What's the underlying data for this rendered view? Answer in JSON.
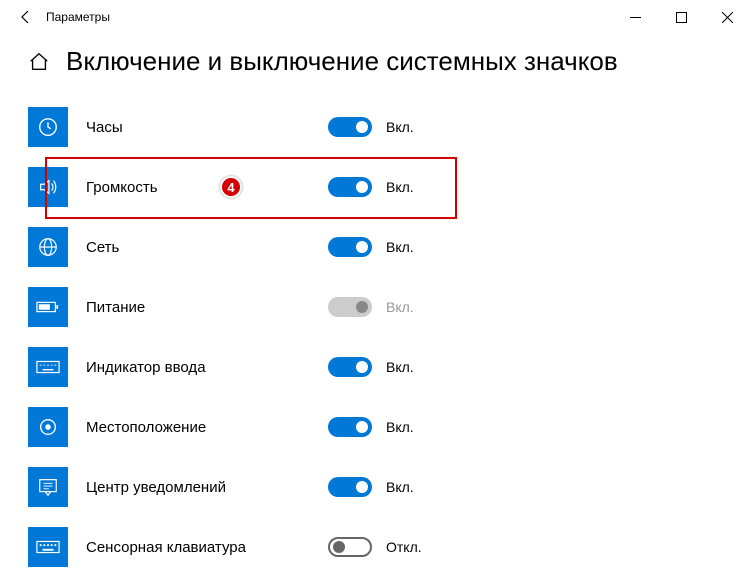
{
  "window": {
    "title": "Параметры"
  },
  "page": {
    "title": "Включение и выключение системных значков"
  },
  "states": {
    "on": "Вкл.",
    "off": "Откл."
  },
  "callout": {
    "number": "4"
  },
  "items": [
    {
      "label": "Часы",
      "state": "on"
    },
    {
      "label": "Громкость",
      "state": "on"
    },
    {
      "label": "Сеть",
      "state": "on"
    },
    {
      "label": "Питание",
      "state": "disabled",
      "stateText": "Вкл."
    },
    {
      "label": "Индикатор ввода",
      "state": "on"
    },
    {
      "label": "Местоположение",
      "state": "on"
    },
    {
      "label": "Центр уведомлений",
      "state": "on"
    },
    {
      "label": "Сенсорная клавиатура",
      "state": "off"
    }
  ]
}
